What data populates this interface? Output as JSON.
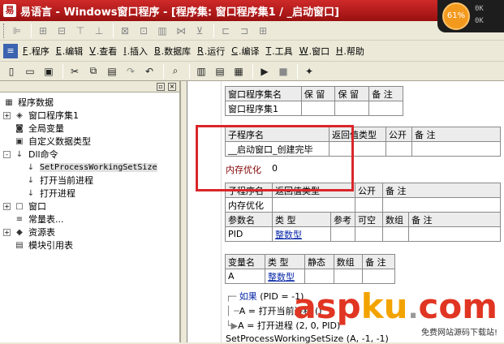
{
  "title": "易语言 - Windows窗口程序 - [程序集: 窗口程序集1 / _启动窗口]",
  "app_icon": "易",
  "cpu": {
    "percent": "61%",
    "up": "0K",
    "down": "0K"
  },
  "menu": [
    {
      "key": "F",
      "label": ".程序"
    },
    {
      "key": "E",
      "label": ".编辑"
    },
    {
      "key": "V",
      "label": ".查看"
    },
    {
      "key": "I",
      "label": ".插入"
    },
    {
      "key": "B",
      "label": ".数据库"
    },
    {
      "key": "R",
      "label": ".运行"
    },
    {
      "key": "C",
      "label": ".编译"
    },
    {
      "key": "T",
      "label": ".工具"
    },
    {
      "key": "W",
      "label": ".窗口"
    },
    {
      "key": "H",
      "label": ".帮助"
    }
  ],
  "tree": {
    "root": "程序数据",
    "items": [
      {
        "label": "窗口程序集1",
        "exp": "+",
        "icon": "assembly-icon",
        "glyph": "◈",
        "level": 1
      },
      {
        "label": "全局变量",
        "exp": "",
        "icon": "global-var-icon",
        "glyph": "◙",
        "level": 1
      },
      {
        "label": "自定义数据类型",
        "exp": "",
        "icon": "datatype-icon",
        "glyph": "▣",
        "level": 1
      },
      {
        "label": "Dll命令",
        "exp": "-",
        "icon": "dll-icon",
        "glyph": "↓",
        "level": 1
      },
      {
        "label": "SetProcessWorkingSetSize",
        "exp": "",
        "icon": "dll-cmd-icon",
        "glyph": "↓",
        "level": 2,
        "mono": true,
        "selected": true
      },
      {
        "label": "打开当前进程",
        "exp": "",
        "icon": "dll-cmd-icon",
        "glyph": "↓",
        "level": 2
      },
      {
        "label": "打开进程",
        "exp": "",
        "icon": "dll-cmd-icon",
        "glyph": "↓",
        "level": 2
      },
      {
        "label": "窗口",
        "exp": "+",
        "icon": "window-icon",
        "glyph": "□",
        "level": 1
      },
      {
        "label": "常量表...",
        "exp": "",
        "icon": "constant-icon",
        "glyph": "≡",
        "level": 1
      },
      {
        "label": "资源表",
        "exp": "+",
        "icon": "resource-icon",
        "glyph": "◆",
        "level": 1
      },
      {
        "label": "模块引用表",
        "exp": "",
        "icon": "module-icon",
        "glyph": "▤",
        "level": 1
      }
    ]
  },
  "editor": {
    "assembly_table": {
      "headers": [
        "窗口程序集名",
        "保 留",
        "保 留",
        "备 注"
      ],
      "row": [
        "窗口程序集1",
        "",
        "",
        ""
      ]
    },
    "sub_table_1": {
      "headers": [
        "子程序名",
        "返回值类型",
        "公开",
        "备 注"
      ],
      "row": [
        "__启动窗口_创建完毕",
        "",
        "",
        ""
      ]
    },
    "standalone_var": "内存优化",
    "caret_text": "0",
    "sub_table_2": {
      "headers": [
        "子程序名",
        "返回值类型",
        "公开",
        "备 注"
      ],
      "row": [
        "内存优化",
        "",
        "",
        ""
      ],
      "param_headers": [
        "参数名",
        "类 型",
        "参考",
        "可空",
        "数组",
        "备 注"
      ],
      "param_row": [
        "PID",
        "整数型",
        "",
        "",
        "",
        ""
      ]
    },
    "var_table": {
      "headers": [
        "变量名",
        "类 型",
        "静态",
        "数组",
        "备 注"
      ],
      "row": [
        "A",
        "整数型",
        "",
        "",
        ""
      ]
    },
    "code": [
      {
        "prefix": "如果",
        "text": " (PID = -1)"
      },
      {
        "prefix": "A = ",
        "text": "打开当前进程 ()"
      },
      {
        "prefix": "A = ",
        "text": "打开进程 (2, 0, PID)"
      },
      {
        "prefix": "",
        "text": "SetProcessWorkingSetSize (A, -1, -1)"
      }
    ]
  },
  "watermark": {
    "asp": "asp",
    "ku": "ku",
    "dot": ".",
    "com": "com",
    "sub": "免费网站源码下载站!"
  }
}
